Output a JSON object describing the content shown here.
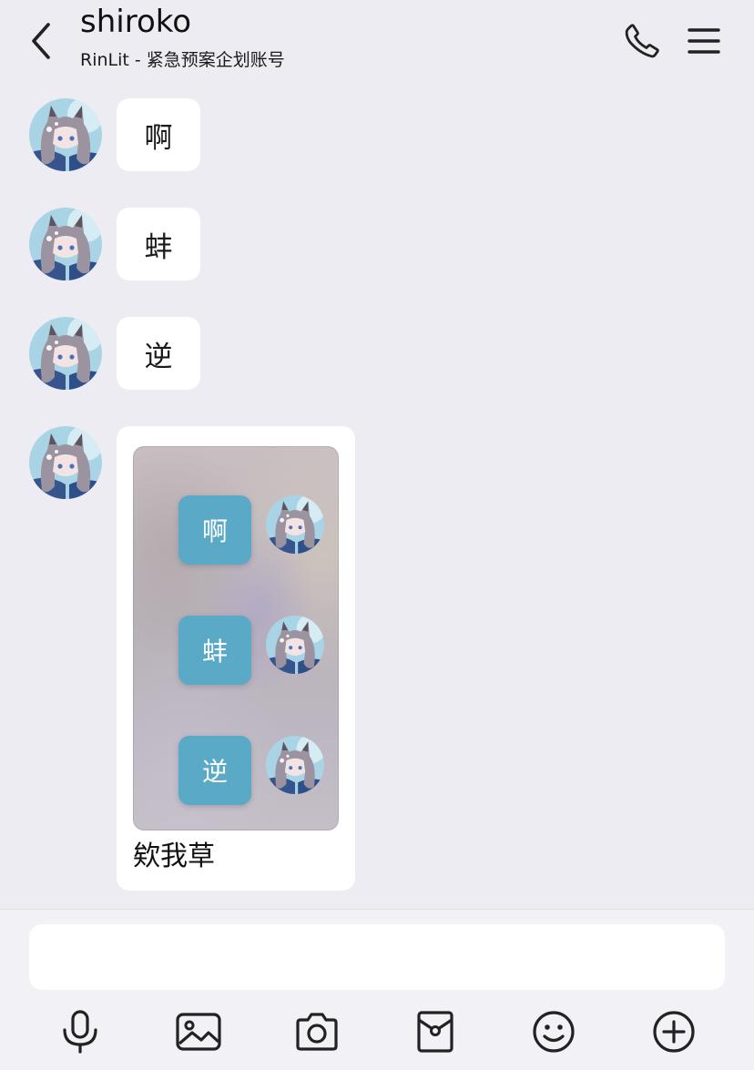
{
  "header": {
    "title": "shiroko",
    "subtitle": "RinLit - 紧急预案企划账号",
    "icons": [
      "chevron-left-icon",
      "phone-icon",
      "menu-icon"
    ]
  },
  "messages": [
    {
      "type": "text",
      "text": "啊"
    },
    {
      "type": "text",
      "text": "蚌"
    },
    {
      "type": "text",
      "text": "逆"
    },
    {
      "type": "image",
      "preview_messages": [
        "啊",
        "蚌",
        "逆"
      ],
      "caption": "欸我草"
    }
  ],
  "input": {
    "value": "",
    "placeholder": ""
  },
  "toolbar": {
    "icons": [
      "microphone-icon",
      "image-icon",
      "camera-icon",
      "red-packet-icon",
      "emoji-icon",
      "plus-icon"
    ]
  },
  "colors": {
    "background": "#ececf2",
    "bubble": "#ffffff",
    "preview_bubble": "#5aa9c7",
    "bottom_bar": "#f1f1f6"
  }
}
